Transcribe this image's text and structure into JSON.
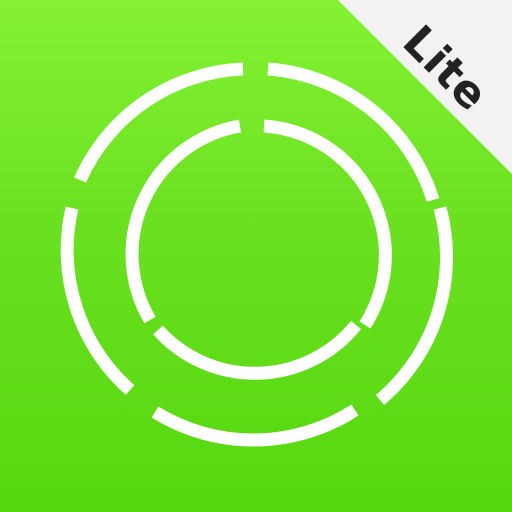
{
  "app": {
    "badge_label": "Lite"
  },
  "colors": {
    "background_top": "#84f233",
    "background_bottom": "#55d80f",
    "ring": "#ffffff",
    "ribbon": "#f2f2f2",
    "badge_text": "#222222"
  },
  "icons": {
    "main_glyph": "concentric-segmented-rings-icon"
  }
}
